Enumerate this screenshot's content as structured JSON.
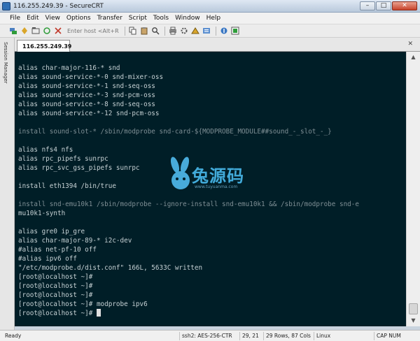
{
  "window": {
    "title": "116.255.249.39 - SecureCRT",
    "minimize": "–",
    "maximize": "□",
    "close": "✕"
  },
  "menu": [
    "File",
    "Edit",
    "View",
    "Options",
    "Transfer",
    "Script",
    "Tools",
    "Window",
    "Help"
  ],
  "toolbar": {
    "quick_connect_placeholder": "Enter host <Alt+R>"
  },
  "session_manager": {
    "label": "Session Manager"
  },
  "tab": {
    "label": "116.255.249.39",
    "close": "✕"
  },
  "terminal": {
    "lines": [
      "",
      "alias char-major-116-* snd",
      "alias sound-service-*-0 snd-mixer-oss",
      "alias sound-service-*-1 snd-seq-oss",
      "alias sound-service-*-3 snd-pcm-oss",
      "alias sound-service-*-8 snd-seq-oss",
      "alias sound-service-*-12 snd-pcm-oss",
      "",
      "install sound-slot-* /sbin/modprobe snd-card-${MODPROBE_MODULE##sound_-_slot_-_}",
      "",
      "alias nfs4 nfs",
      "alias rpc_pipefs sunrpc",
      "alias rpc_svc_gss_pipefs sunrpc",
      "",
      "install eth1394 /bin/true",
      "",
      "install snd-emu10k1 /sbin/modprobe --ignore-install snd-emu10k1 && /sbin/modprobe snd-e",
      "mu10k1-synth",
      "",
      "alias gre0 ip_gre",
      "alias char-major-89-* i2c-dev",
      "#alias net-pf-10 off",
      "#alias ipv6 off",
      "\"/etc/modprobe.d/dist.conf\" 166L, 5633C written",
      "[root@localhost ~]#",
      "[root@localhost ~]#",
      "[root@localhost ~]#",
      "[root@localhost ~]# modprobe ipv6",
      "[root@localhost ~]# "
    ],
    "dim_lines": [
      8,
      16
    ]
  },
  "watermark": {
    "text": "兔源码",
    "url": "www.tuyuanma.com"
  },
  "status": {
    "ready": "Ready",
    "protocol": "ssh2: AES-256-CTR",
    "position": "29, 21",
    "size": "29 Rows, 87 Cols",
    "terminal_type": "Linux",
    "keys": "CAP NUM"
  }
}
